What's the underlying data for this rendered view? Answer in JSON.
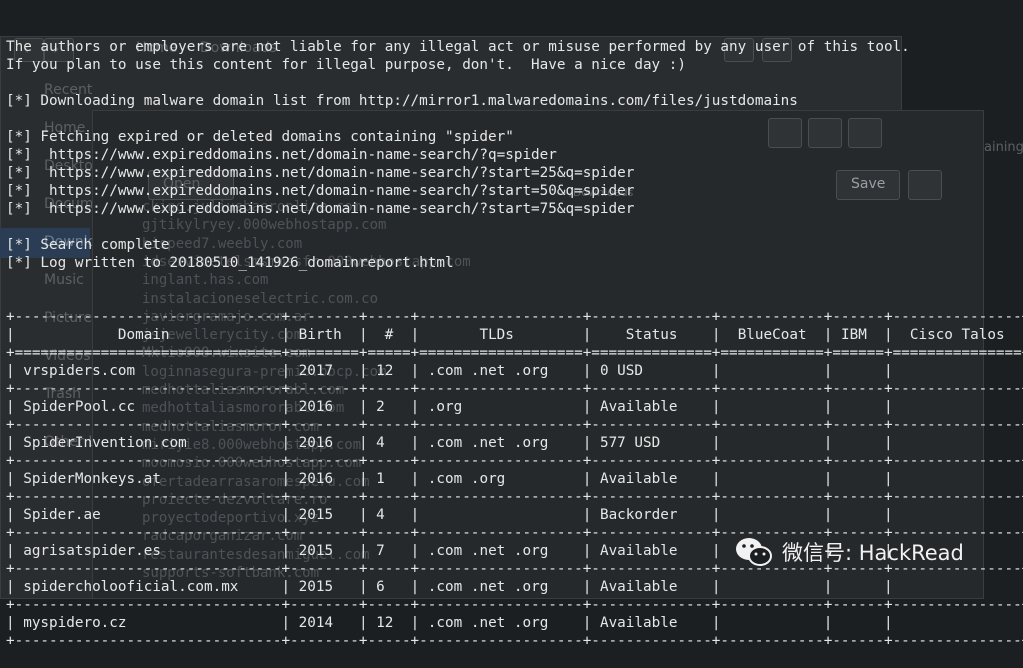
{
  "background": {
    "nav_back": "‹",
    "nav_forward": "›",
    "breadcrumb_home": "Home",
    "breadcrumb_downloads": "Downloads",
    "sidebar_items": [
      "Recent",
      "Home",
      "Desktop",
      "Documents",
      "Downloads",
      "Music",
      "Pictures",
      "Videos",
      "Trash",
      "Other Locations"
    ],
    "open_button": "Open",
    "save_button": "Save",
    "path_label": "~/Downloads",
    "tab_partial": "aining",
    "ghost_domains": [
      "cking.juliusbaeronline.com",
      "gjtikylryey.000webhostapp.com",
      "hispeed7.weebly.com",
      "idservicetelsmsmmssfr.000webhostapp.com",
      "inglant.has.com",
      "instalacioneselectric.com.co",
      "javiergramajo.com.ar",
      "jsjewellerycity.com",
      "Mklio908.wixsite.com",
      "loginnasegura-premio.bbcp.com",
      "medhottaliasmororabl.com",
      "medhottaliasmororabl.com",
      "medhottaliasmoror.com",
      "miriyie8.000webhostapp.com",
      "moomosio.000webhostapp.com",
      "ofertadearrasaromesperu.com",
      "proiecte-dezvoltare.ro",
      "proyectodeportivo.xyz",
      "radcaporganizar.com",
      "restaurantesdesanmiguel.com",
      "supports-softbank.com"
    ]
  },
  "terminal": {
    "lines": [
      "The authors or employers are not liable for any illegal act or misuse performed by any user of this tool.",
      "If you plan to use this content for illegal purpose, don't.  Have a nice day :)",
      "",
      "[*] Downloading malware domain list from http://mirror1.malwaredomains.com/files/justdomains",
      "",
      "[*] Fetching expired or deleted domains containing \"spider\"",
      "[*]  https://www.expireddomains.net/domain-name-search/?q=spider",
      "[*]  https://www.expireddomains.net/domain-name-search/?start=25&q=spider",
      "[*]  https://www.expireddomains.net/domain-name-search/?start=50&q=spider",
      "[*]  https://www.expireddomains.net/domain-name-search/?start=75&q=spider",
      "",
      "[*] Search complete",
      "[*] Log written to 20180510_141926_domainreport.html"
    ],
    "table": {
      "headers": [
        "Domain",
        "Birth",
        "#",
        "TLDs",
        "Status",
        "BlueCoat",
        "IBM",
        "Cisco Talos"
      ],
      "rows": [
        [
          "vrspiders.com",
          "2017",
          "12",
          ".com .net .org",
          "0 USD",
          "",
          "",
          ""
        ],
        [
          "SpiderPool.cc",
          "2016",
          "2",
          ".org",
          "Available",
          "",
          "",
          ""
        ],
        [
          "SpiderInvention.com",
          "2016",
          "4",
          ".com .net .org",
          "577 USD",
          "",
          "",
          ""
        ],
        [
          "SpiderMonkeys.at",
          "2016",
          "1",
          ".com .org",
          "Available",
          "",
          "",
          ""
        ],
        [
          "Spider.ae",
          "2015",
          "4",
          "",
          "Backorder",
          "",
          "",
          ""
        ],
        [
          "agrisatspider.es",
          "2015",
          "7",
          ".com .net .org",
          "Available",
          "",
          "",
          ""
        ],
        [
          "spidercholooficial.com.mx",
          "2015",
          "6",
          ".com .net .org",
          "Available",
          "",
          "",
          ""
        ],
        [
          "myspidero.cz",
          "2014",
          "12",
          ".com .net .org",
          "Available",
          "",
          "",
          ""
        ]
      ]
    }
  },
  "watermark": {
    "text": "微信号: HackRead"
  }
}
